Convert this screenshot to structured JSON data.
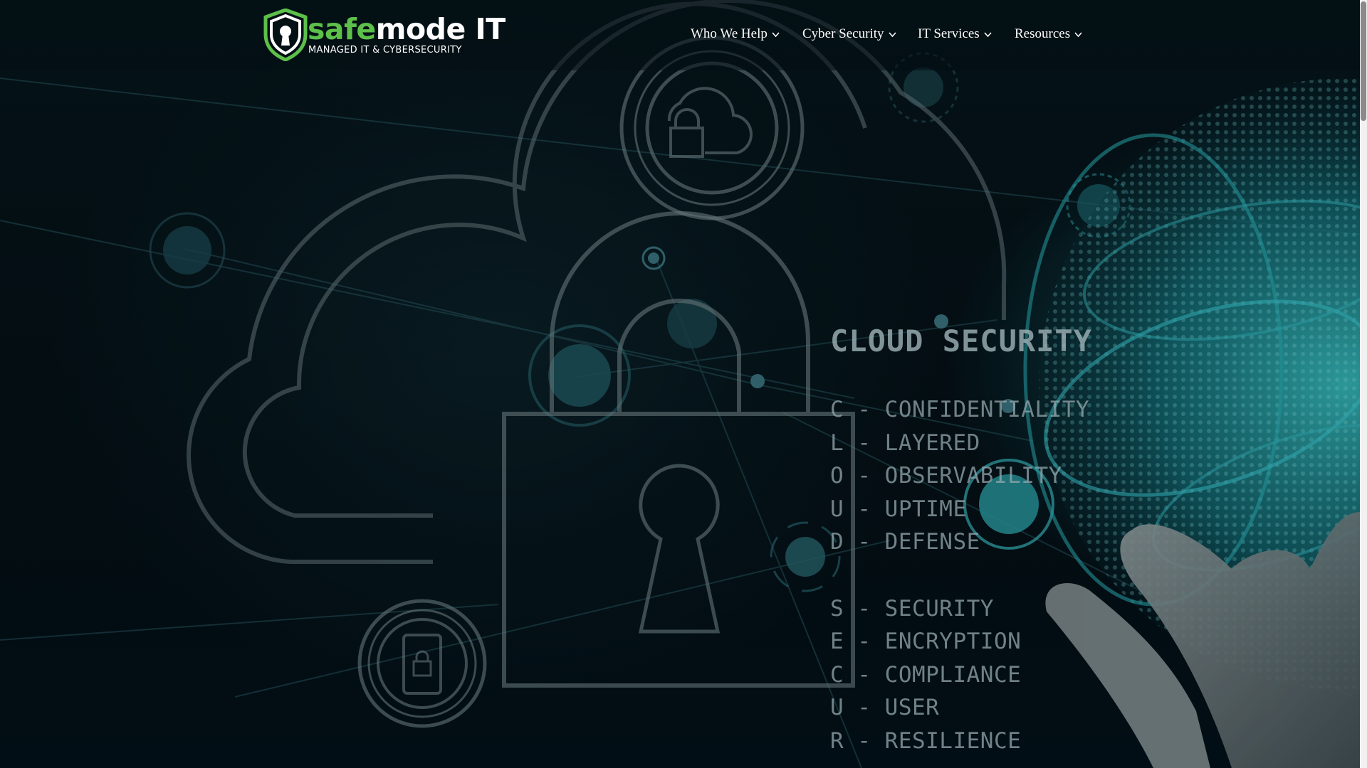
{
  "brand": {
    "name_part1": "safe",
    "name_part2": "mode IT",
    "tagline": "MANAGED IT & CYBERSECURITY",
    "color_green": "#5cc04a",
    "color_white": "#ffffff"
  },
  "nav": {
    "items": [
      {
        "label": "Who We Help"
      },
      {
        "label": "Cyber Security"
      },
      {
        "label": "IT Services"
      },
      {
        "label": "Resources"
      }
    ]
  },
  "hero": {
    "title": "CLOUD SECURITY",
    "rows": [
      "C - CONFIDENTIALITY",
      "L - LAYERED",
      "O - OBSERVABILITY",
      "U - UPTIME",
      "D - DEFENSE",
      "S - SECURITY",
      "E - ENCRYPTION",
      "C - COMPLIANCE",
      "U - USER",
      "R - RESILIENCE"
    ],
    "accent_color": "#1e96a0",
    "icons": [
      "cloud-lock-icon",
      "padlock-icon",
      "keyhole-icon",
      "phone-lock-icon",
      "globe-icon",
      "hand-image"
    ]
  }
}
